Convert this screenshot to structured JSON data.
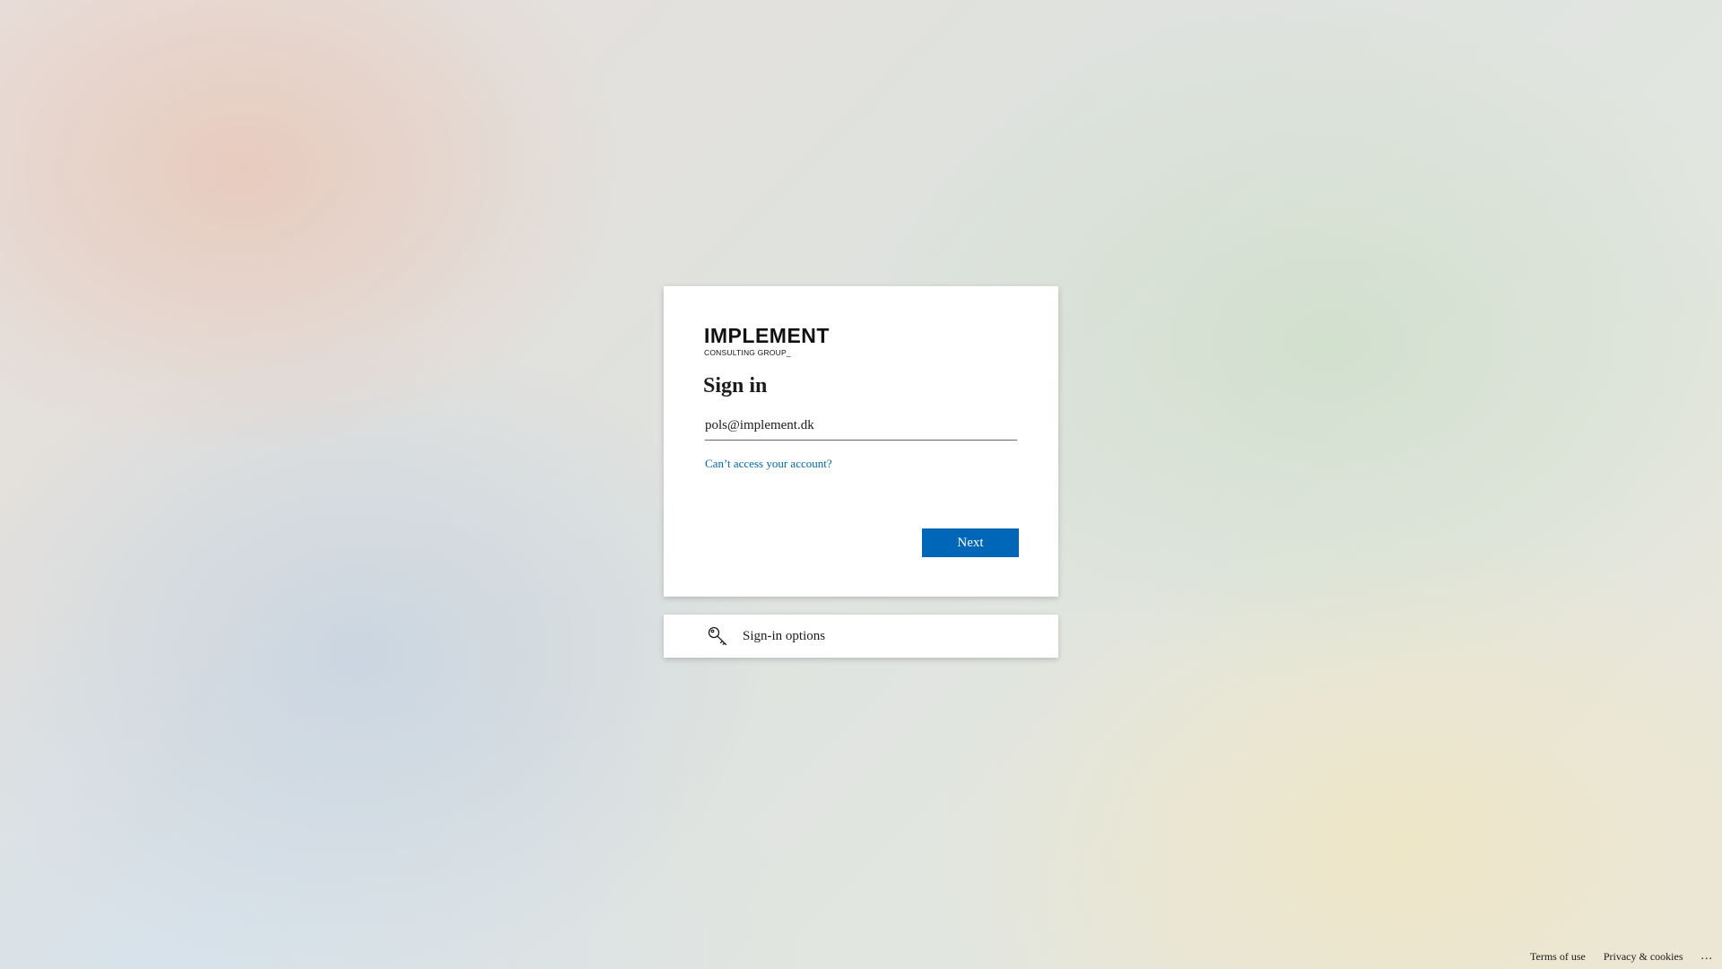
{
  "brand": {
    "name": "IMPLEMENT",
    "tagline": "CONSULTING GROUP_"
  },
  "signin": {
    "title": "Sign in",
    "email_value": "pols@implement.dk",
    "cant_access_label": "Can’t access your account?",
    "next_label": "Next"
  },
  "options": {
    "label": "Sign-in options",
    "icon": "key-icon"
  },
  "footer": {
    "terms_label": "Terms of use",
    "privacy_label": "Privacy & cookies",
    "more_label": "..."
  },
  "colors": {
    "accent": "#0067b8",
    "link": "#0067b8",
    "card_background": "#ffffff"
  }
}
